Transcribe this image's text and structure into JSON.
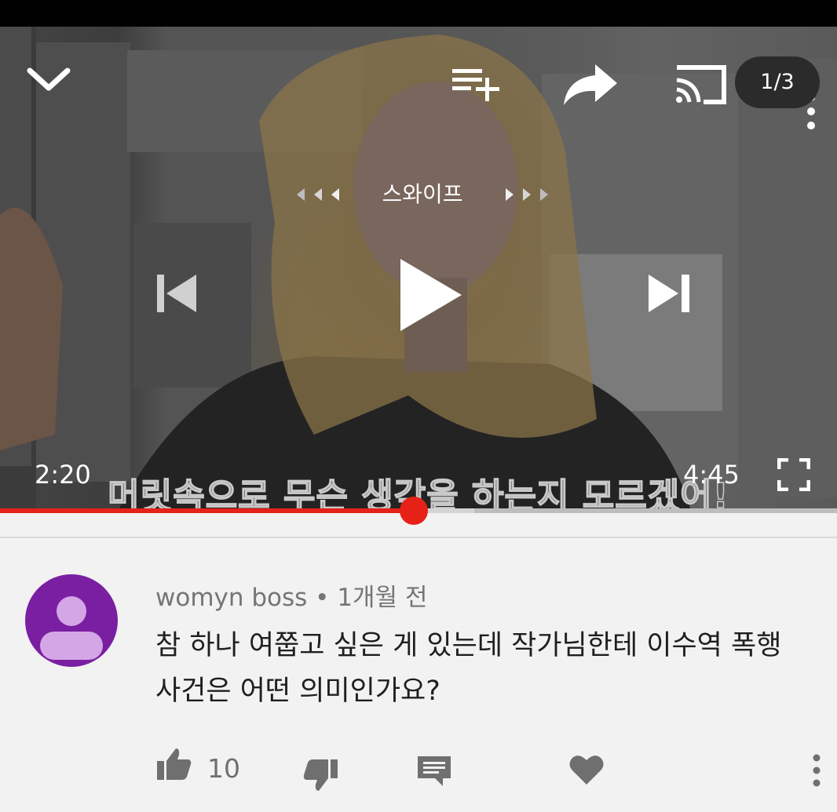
{
  "player": {
    "page_indicator": "1/3",
    "swipe_hint": "스와이프",
    "subtitle": "머릿속으로 무슨 생각을 하는지 모르겠어!",
    "current_time": "2:20",
    "duration": "4:45",
    "progress_fraction": 0.494,
    "buffered_fraction": 0.567,
    "icons": [
      "chevron-down-icon",
      "add-to-queue-icon",
      "share-icon",
      "cast-icon",
      "more-vert-icon",
      "previous-icon",
      "play-icon",
      "next-icon",
      "fullscreen-icon"
    ],
    "accent_color": "#e62117"
  },
  "comment": {
    "author": "womyn boss",
    "separator": "•",
    "age": "1개월 전",
    "text": "참 하나 여쭙고 싶은 게 있는데 작가님한테 이수역 폭행 사건은 어떤 의미인가요?",
    "like_count": "10",
    "avatar_color": "#7b1fa2",
    "icons": [
      "thumbs-up-icon",
      "thumbs-down-icon",
      "reply-icon",
      "heart-icon",
      "more-vert-icon"
    ]
  }
}
